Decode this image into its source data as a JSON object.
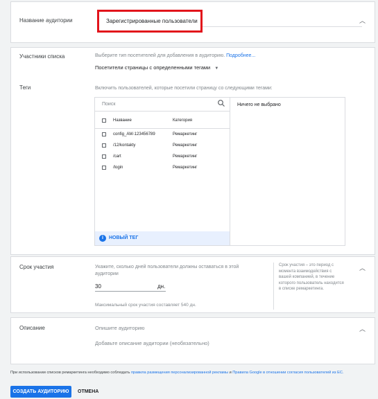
{
  "audience_name": {
    "label": "Название аудитории",
    "value": "Зарегистрированные пользователи"
  },
  "members": {
    "label": "Участники списка",
    "hint": "Выберите тип посетителей для добавления в аудиторию.",
    "more_link": "Подробнее...",
    "selected": "Посетители страницы с определенными тегами"
  },
  "tags": {
    "label": "Теги",
    "hint": "Включить пользователей, которые посетили страницу со следующими тегами:",
    "search_placeholder": "Поиск",
    "col_name": "Название",
    "col_category": "Категория",
    "rows": [
      {
        "name": "config_AW-123456789",
        "category": "Ремаркетинг"
      },
      {
        "name": "/12/kontakty",
        "category": "Ремаркетинг"
      },
      {
        "name": "/cart",
        "category": "Ремаркетинг"
      },
      {
        "name": "/login",
        "category": "Ремаркетинг"
      }
    ],
    "new_tag": "НОВЫЙ ТЕГ",
    "nothing_selected": "Ничего не выбрано"
  },
  "duration": {
    "label": "Срок участия",
    "hint": "Укажите, сколько дней пользователи должны оставаться в этой аудитории",
    "value": "30",
    "unit": "дн.",
    "max_note": "Максимальный срок участия составляет 540 дн.",
    "side_note": "Срок участия – это период с момента взаимодействия с вашей компанией, в течение которого пользователь находится в списке ремаркетинга."
  },
  "description": {
    "label": "Описание",
    "title_placeholder": "Опишите аудиторию",
    "desc_placeholder": "Добавьте описание аудитории (необязательно)"
  },
  "footer": {
    "policy_prefix": "При использовании списков ремаркетинга необходимо соблюдать",
    "policy_link1": "правила размещения персонализированной рекламы",
    "policy_and": "и",
    "policy_link2": "Правила Google в отношении согласия пользователей из ЕС.",
    "create_button": "СОЗДАТЬ АУДИТОРИЮ",
    "cancel_button": "ОТМЕНА"
  },
  "colors": {
    "accent": "#1a73e8",
    "highlight_border": "#e2141b"
  }
}
